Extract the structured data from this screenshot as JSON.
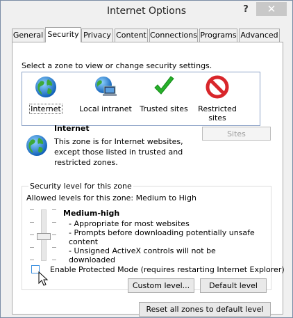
{
  "window": {
    "title": "Internet Options",
    "help_label": "?",
    "close_label": "✕"
  },
  "tabs": [
    "General",
    "Security",
    "Privacy",
    "Content",
    "Connections",
    "Programs",
    "Advanced"
  ],
  "active_tab": "Security",
  "security": {
    "instruction": "Select a zone to view or change security settings.",
    "zones": [
      {
        "label": "Internet",
        "icon": "globe-icon",
        "selected": true
      },
      {
        "label": "Local intranet",
        "icon": "local-intranet-icon",
        "selected": false
      },
      {
        "label": "Trusted sites",
        "icon": "checkmark-icon",
        "selected": false
      },
      {
        "label": "Restricted sites",
        "label_line1": "Restricted",
        "label_line2": "sites",
        "icon": "no-entry-icon",
        "selected": false
      }
    ],
    "zone_detail": {
      "name": "Internet",
      "description": "This zone is for Internet websites, except those listed in trusted and restricted zones."
    },
    "sites_button": "Sites",
    "group_label": "Security level for this zone",
    "allowed_levels": "Allowed levels for this zone: Medium to High",
    "level": {
      "name": "Medium-high",
      "bullets": [
        "- Appropriate for most websites",
        "- Prompts before downloading potentially unsafe content",
        "- Unsigned ActiveX controls will not be downloaded"
      ]
    },
    "protected_mode": {
      "label": "Enable Protected Mode (requires restarting Internet Explorer)",
      "checked": false
    },
    "custom_level_button": "Custom level...",
    "default_level_button": "Default level",
    "reset_button": "Reset all zones to default level"
  }
}
